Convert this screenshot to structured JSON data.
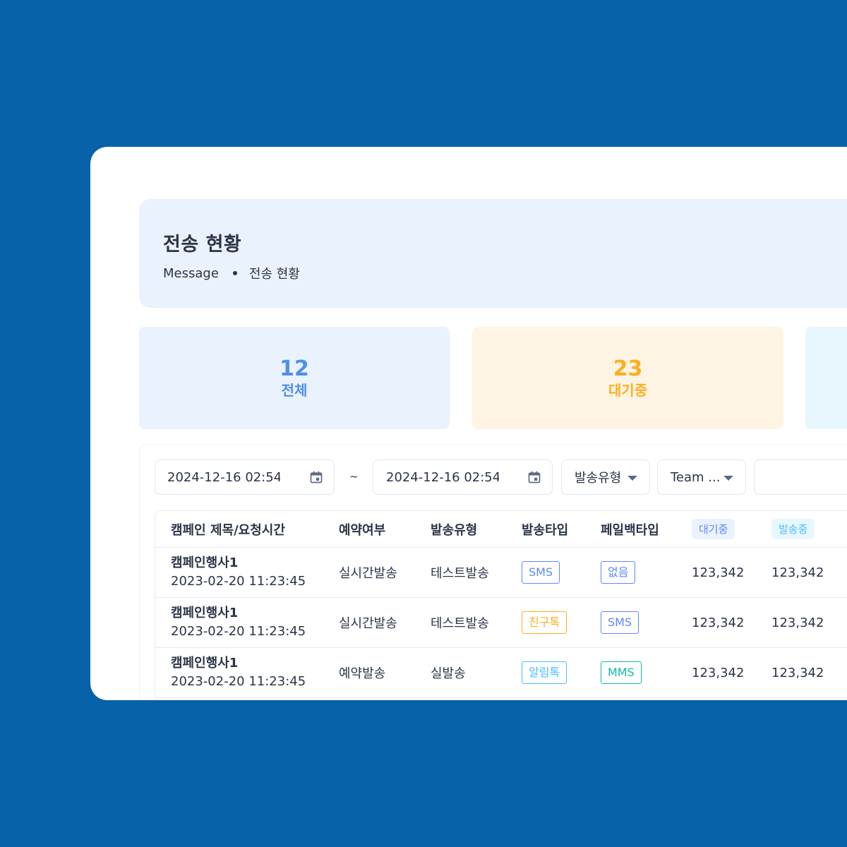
{
  "page": {
    "title": "전송 현황",
    "breadcrumb": [
      "Message",
      "전송 현황"
    ]
  },
  "stats": [
    {
      "value": "12",
      "label": "전체"
    },
    {
      "value": "23",
      "label": "대기중"
    }
  ],
  "filters": {
    "start_date": "2024-12-16 02:54",
    "separator": "~",
    "end_date": "2024-12-16 02:54",
    "send_type_select": "발송유형",
    "team_select": "Team ..."
  },
  "table": {
    "headers": [
      "캠페인 제목/요청시간",
      "예약여부",
      "발송유형",
      "발송타입",
      "페일백타입",
      "대기중",
      "발송중"
    ],
    "rows": [
      {
        "name": "캠페인행사1",
        "time": "2023-02-20 11:23:45",
        "reserve": "실시간발송",
        "send_kind": "테스트발송",
        "send_type": "SMS",
        "fallback": "없음",
        "waiting": "123,342",
        "sending": "123,342"
      },
      {
        "name": "캠페인행사1",
        "time": "2023-02-20 11:23:45",
        "reserve": "실시간발송",
        "send_kind": "테스트발송",
        "send_type": "친구톡",
        "fallback": "SMS",
        "waiting": "123,342",
        "sending": "123,342"
      },
      {
        "name": "캠페인행사1",
        "time": "2023-02-20 11:23:45",
        "reserve": "예약발송",
        "send_kind": "실발송",
        "send_type": "알림톡",
        "fallback": "MMS",
        "waiting": "123,342",
        "sending": "123,342"
      }
    ]
  },
  "colors": {
    "background": "#0762a9",
    "total": "#4f8fe6",
    "waiting": "#ffae1f",
    "sending": "#49beff"
  },
  "icons": {
    "date_picker": "calendar-icon",
    "select": "caret-down-icon"
  }
}
